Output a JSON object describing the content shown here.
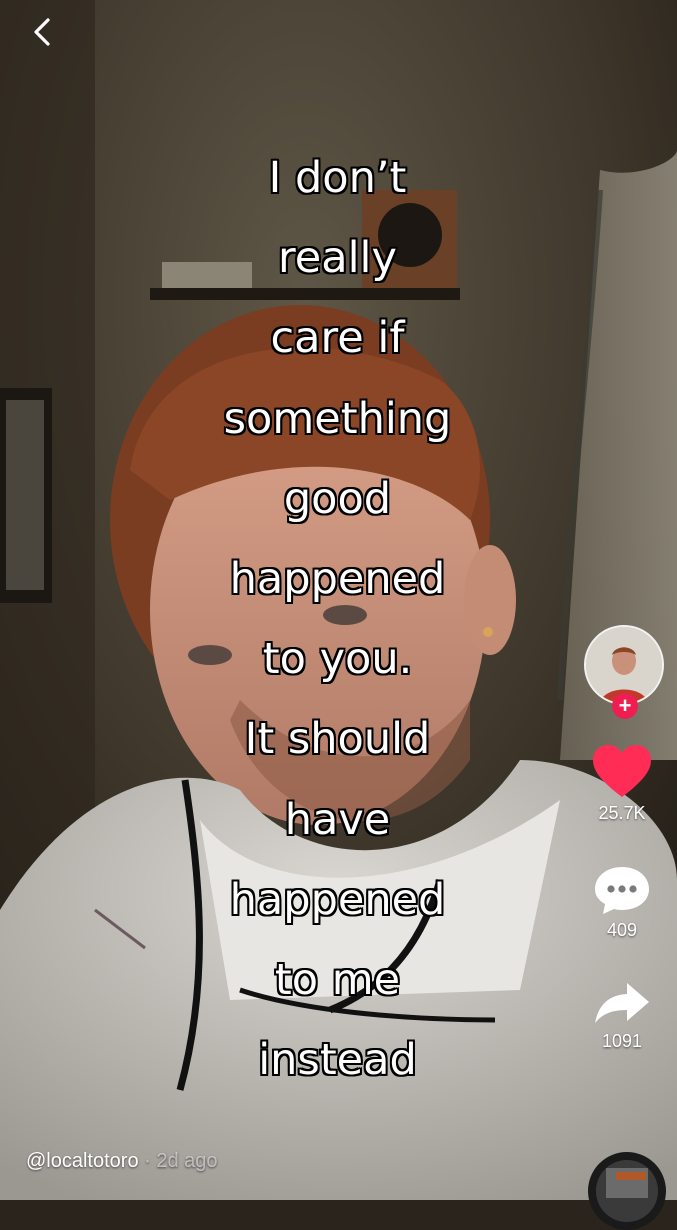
{
  "caption": {
    "lines": [
      "I don’t",
      "really",
      "care if",
      "something",
      "good",
      "happened",
      "to you.",
      "It should",
      "have",
      "happened",
      "to me",
      "instead"
    ]
  },
  "actions": {
    "likes": "25.7K",
    "comments": "409",
    "shares": "1091"
  },
  "author": {
    "username": "@localtotoro",
    "separator": "·",
    "posted": "2d ago"
  },
  "colors": {
    "like": "#ff2d55",
    "follow": "#ee1d52"
  }
}
